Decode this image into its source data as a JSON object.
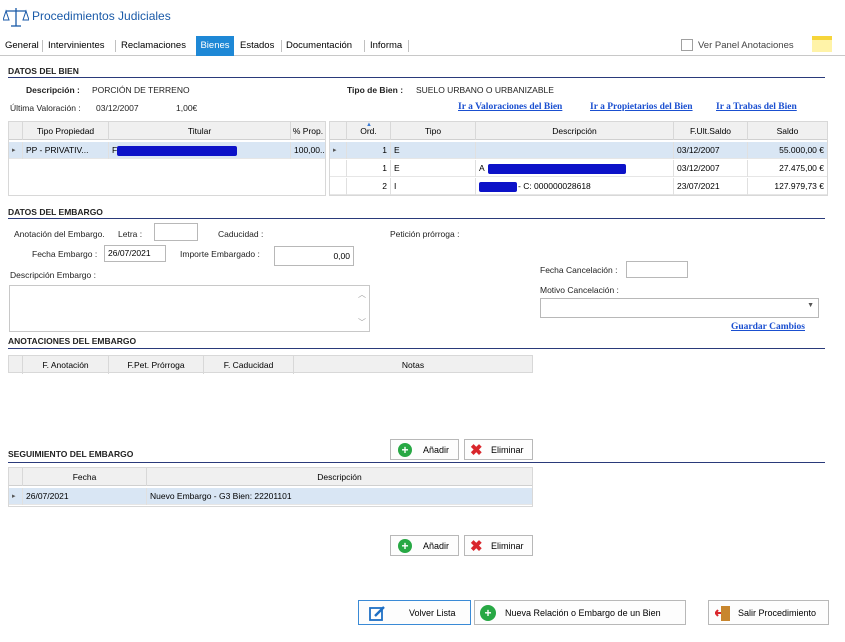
{
  "app": {
    "title": "Procedimientos Judiciales"
  },
  "tabs": [
    "General",
    "Intervinientes",
    "Reclamaciones",
    "Bienes",
    "Estados",
    "Documentación",
    "Informa"
  ],
  "annotations_panel": {
    "label": "Ver Panel Anotaciones"
  },
  "datos_bien": {
    "title": "DATOS DEL BIEN",
    "descripcion_label": "Descripción :",
    "descripcion_value": "PORCIÓN DE TERRENO",
    "tipo_bien_label": "Tipo de Bien :",
    "tipo_bien_value": "SUELO URBANO O URBANIZABLE",
    "ultima_valoracion_label": "Última Valoración :",
    "ultima_valoracion_date": "03/12/2007",
    "ultima_valoracion_amount": "1,00€",
    "links": [
      "Ir a Valoraciones del Bien",
      "Ir a Propietarios del Bien",
      "Ir a Trabas del Bien"
    ]
  },
  "owners_grid": {
    "headers": [
      "Tipo Propiedad",
      "Titular",
      "% Prop."
    ],
    "rows": [
      {
        "tipo": "PP - PRIVATIV...",
        "titular": "F",
        "prop": "100,00..."
      }
    ]
  },
  "saldos_grid": {
    "headers": [
      "Ord.",
      "Tipo",
      "Descripción",
      "F.Ult.Saldo",
      "Saldo"
    ],
    "rows": [
      {
        "ord": "1",
        "tipo": "E",
        "desc": "",
        "fecha": "03/12/2007",
        "saldo": "55.000,00 €"
      },
      {
        "ord": "1",
        "tipo": "E",
        "desc": "A",
        "fecha": "03/12/2007",
        "saldo": "27.475,00 €"
      },
      {
        "ord": "2",
        "tipo": "I",
        "desc": "- C: 000000028618",
        "fecha": "23/07/2021",
        "saldo": "127.979,73 €"
      }
    ]
  },
  "embargo": {
    "title": "DATOS DEL EMBARGO",
    "anotacion_label": "Anotación del Embargo.",
    "letra_label": "Letra :",
    "caducidad_label": "Caducidad :",
    "peticion_label": "Petición prórroga :",
    "fecha_label": "Fecha Embargo :",
    "fecha_value": "26/07/2021",
    "importe_label": "Importe Embargado :",
    "importe_value": "0,00",
    "descripcion_label": "Descripción Embargo :",
    "fecha_cancel_label": "Fecha Cancelación :",
    "motivo_cancel_label": "Motivo Cancelación :",
    "guardar": "Guardar Cambios"
  },
  "anotaciones": {
    "title": "ANOTACIONES DEL EMBARGO",
    "headers": [
      "F. Anotación",
      "F.Pet. Prórroga",
      "F. Caducidad",
      "Notas"
    ],
    "add": "Añadir",
    "delete": "Eliminar"
  },
  "seguimiento": {
    "title": "SEGUIMIENTO DEL EMBARGO",
    "headers": [
      "Fecha",
      "Descripción"
    ],
    "rows": [
      {
        "fecha": "26/07/2021",
        "desc": "Nuevo Embargo - G3 Bien: 22201101"
      }
    ],
    "add": "Añadir",
    "delete": "Eliminar"
  },
  "footer": {
    "volver": "Volver Lista",
    "nueva": "Nueva Relación o  Embargo de un Bien",
    "salir": "Salir Procedimiento"
  },
  "colors": {
    "accent": "#1e88d6",
    "link": "#1a4fd0",
    "add": "#27a844",
    "delete": "#d9262c"
  }
}
